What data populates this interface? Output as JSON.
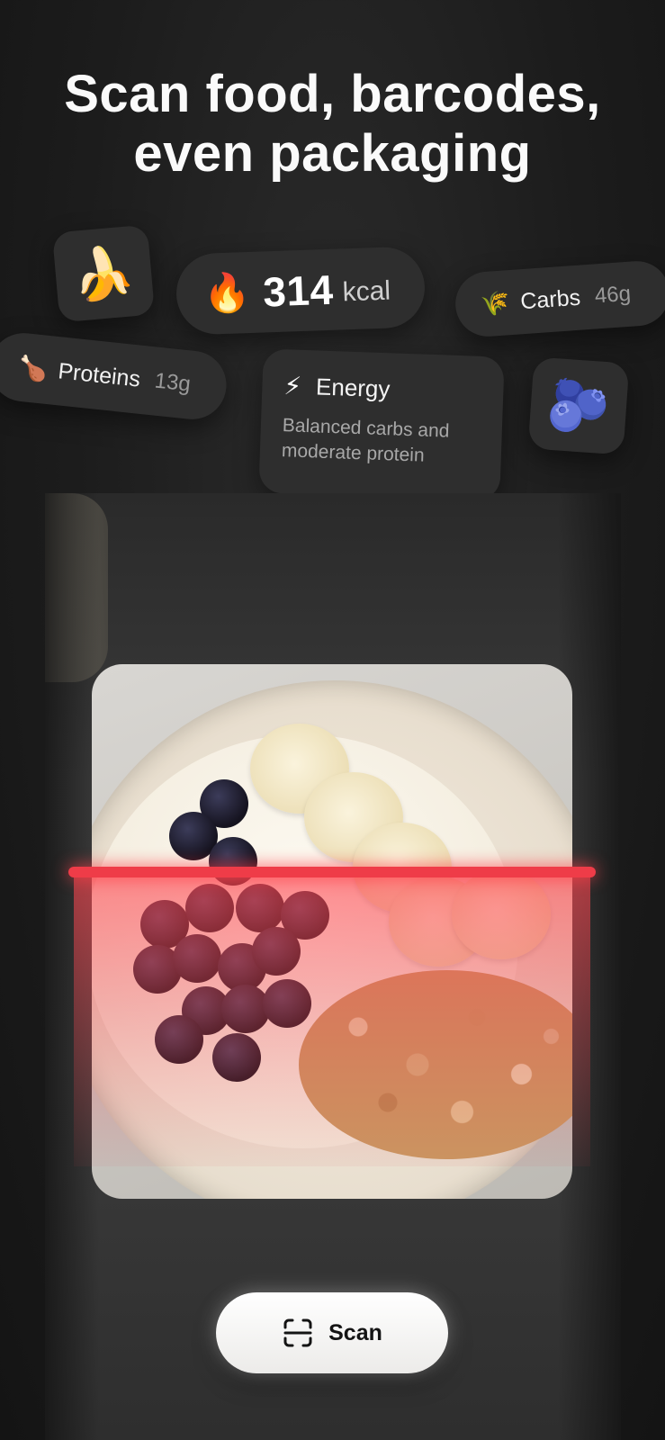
{
  "headline": {
    "line1": "Scan food, barcodes,",
    "line2": "even packaging"
  },
  "cards": {
    "banana_icon": "🍌",
    "calories": {
      "icon": "🔥",
      "value": "314",
      "unit": "kcal"
    },
    "carbs": {
      "icon": "🌾",
      "label": "Carbs",
      "amount": "46g"
    },
    "proteins": {
      "icon": "🍗",
      "label": "Proteins",
      "amount": "13g"
    },
    "energy": {
      "icon": "⚡",
      "title": "Energy",
      "description": "Balanced carbs and moderate protein"
    },
    "blueberry_icon": "🫐"
  },
  "scanner": {
    "accent_color": "#ef3c48"
  },
  "scan_button": {
    "label": "Scan",
    "icon": "scan-frame-icon"
  }
}
